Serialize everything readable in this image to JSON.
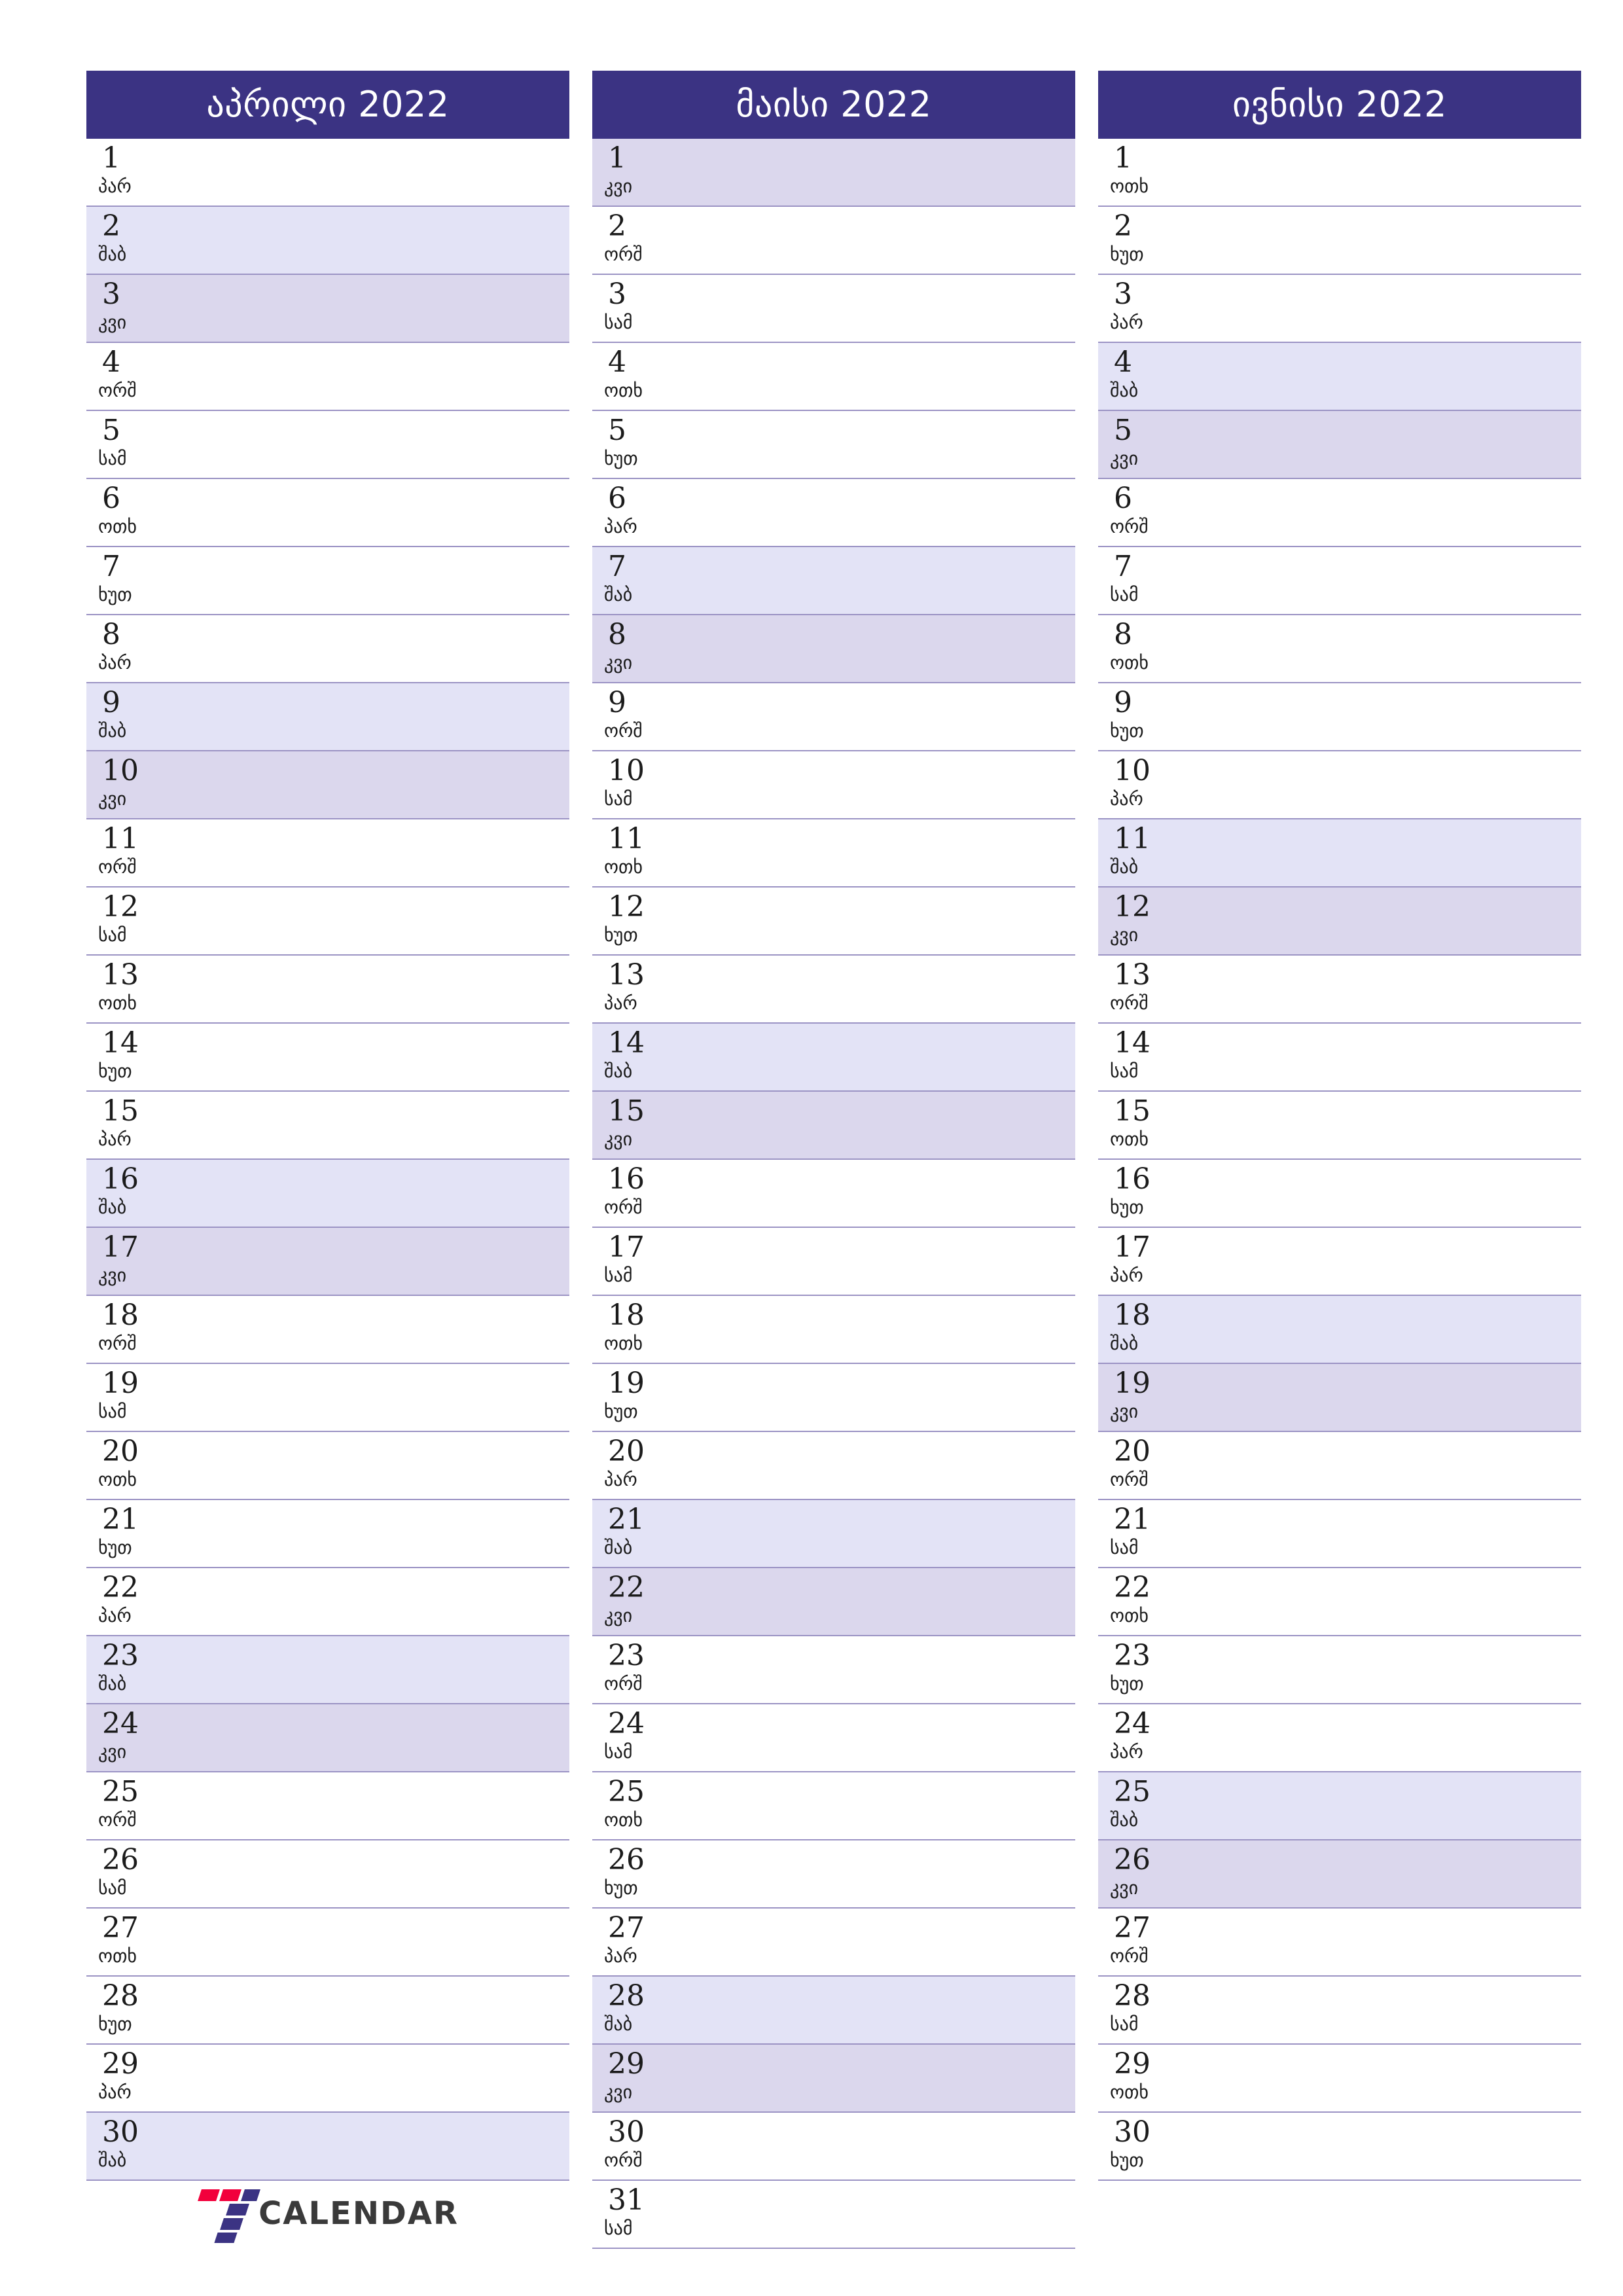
{
  "document": {
    "type": "calendar-planner",
    "year": "2022",
    "locale": "ka",
    "page_size": "A4-portrait"
  },
  "colors": {
    "header_bg": "#3B3383",
    "header_text": "#FFFFFF",
    "saturday_bg": "#E3E3F6",
    "sunday_bg": "#DBD7ED",
    "weekday_bg": "#FFFFFF",
    "row_divider": "#9B93C4",
    "day_text": "#1B1B1B",
    "logo_red": "#F2003C",
    "logo_purple": "#3B3383",
    "logo_text": "#3A3A3A"
  },
  "weekday_abbr": {
    "mon": "ორშ",
    "tue": "სამ",
    "wed": "ოთხ",
    "thu": "ხუთ",
    "fri": "პარ",
    "sat": "შაბ",
    "sun": "კვი"
  },
  "logo": {
    "mark": "seven-logo-mark",
    "text": "CALENDAR"
  },
  "months": [
    {
      "title": "აპრილი 2022",
      "name": "აპრილი",
      "year": "2022",
      "days": [
        {
          "n": "1",
          "w": "პარ",
          "t": "weekday"
        },
        {
          "n": "2",
          "w": "შაბ",
          "t": "sat"
        },
        {
          "n": "3",
          "w": "კვი",
          "t": "sun"
        },
        {
          "n": "4",
          "w": "ორშ",
          "t": "weekday"
        },
        {
          "n": "5",
          "w": "სამ",
          "t": "weekday"
        },
        {
          "n": "6",
          "w": "ოთხ",
          "t": "weekday"
        },
        {
          "n": "7",
          "w": "ხუთ",
          "t": "weekday"
        },
        {
          "n": "8",
          "w": "პარ",
          "t": "weekday"
        },
        {
          "n": "9",
          "w": "შაბ",
          "t": "sat"
        },
        {
          "n": "10",
          "w": "კვი",
          "t": "sun"
        },
        {
          "n": "11",
          "w": "ორშ",
          "t": "weekday"
        },
        {
          "n": "12",
          "w": "სამ",
          "t": "weekday"
        },
        {
          "n": "13",
          "w": "ოთხ",
          "t": "weekday"
        },
        {
          "n": "14",
          "w": "ხუთ",
          "t": "weekday"
        },
        {
          "n": "15",
          "w": "პარ",
          "t": "weekday"
        },
        {
          "n": "16",
          "w": "შაბ",
          "t": "sat"
        },
        {
          "n": "17",
          "w": "კვი",
          "t": "sun"
        },
        {
          "n": "18",
          "w": "ორშ",
          "t": "weekday"
        },
        {
          "n": "19",
          "w": "სამ",
          "t": "weekday"
        },
        {
          "n": "20",
          "w": "ოთხ",
          "t": "weekday"
        },
        {
          "n": "21",
          "w": "ხუთ",
          "t": "weekday"
        },
        {
          "n": "22",
          "w": "პარ",
          "t": "weekday"
        },
        {
          "n": "23",
          "w": "შაბ",
          "t": "sat"
        },
        {
          "n": "24",
          "w": "კვი",
          "t": "sun"
        },
        {
          "n": "25",
          "w": "ორშ",
          "t": "weekday"
        },
        {
          "n": "26",
          "w": "სამ",
          "t": "weekday"
        },
        {
          "n": "27",
          "w": "ოთხ",
          "t": "weekday"
        },
        {
          "n": "28",
          "w": "ხუთ",
          "t": "weekday"
        },
        {
          "n": "29",
          "w": "პარ",
          "t": "weekday"
        },
        {
          "n": "30",
          "w": "შაბ",
          "t": "sat"
        }
      ]
    },
    {
      "title": "მაისი 2022",
      "name": "მაისი",
      "year": "2022",
      "days": [
        {
          "n": "1",
          "w": "კვი",
          "t": "sun"
        },
        {
          "n": "2",
          "w": "ორშ",
          "t": "weekday"
        },
        {
          "n": "3",
          "w": "სამ",
          "t": "weekday"
        },
        {
          "n": "4",
          "w": "ოთხ",
          "t": "weekday"
        },
        {
          "n": "5",
          "w": "ხუთ",
          "t": "weekday"
        },
        {
          "n": "6",
          "w": "პარ",
          "t": "weekday"
        },
        {
          "n": "7",
          "w": "შაბ",
          "t": "sat"
        },
        {
          "n": "8",
          "w": "კვი",
          "t": "sun"
        },
        {
          "n": "9",
          "w": "ორშ",
          "t": "weekday"
        },
        {
          "n": "10",
          "w": "სამ",
          "t": "weekday"
        },
        {
          "n": "11",
          "w": "ოთხ",
          "t": "weekday"
        },
        {
          "n": "12",
          "w": "ხუთ",
          "t": "weekday"
        },
        {
          "n": "13",
          "w": "პარ",
          "t": "weekday"
        },
        {
          "n": "14",
          "w": "შაბ",
          "t": "sat"
        },
        {
          "n": "15",
          "w": "კვი",
          "t": "sun"
        },
        {
          "n": "16",
          "w": "ორშ",
          "t": "weekday"
        },
        {
          "n": "17",
          "w": "სამ",
          "t": "weekday"
        },
        {
          "n": "18",
          "w": "ოთხ",
          "t": "weekday"
        },
        {
          "n": "19",
          "w": "ხუთ",
          "t": "weekday"
        },
        {
          "n": "20",
          "w": "პარ",
          "t": "weekday"
        },
        {
          "n": "21",
          "w": "შაბ",
          "t": "sat"
        },
        {
          "n": "22",
          "w": "კვი",
          "t": "sun"
        },
        {
          "n": "23",
          "w": "ორშ",
          "t": "weekday"
        },
        {
          "n": "24",
          "w": "სამ",
          "t": "weekday"
        },
        {
          "n": "25",
          "w": "ოთხ",
          "t": "weekday"
        },
        {
          "n": "26",
          "w": "ხუთ",
          "t": "weekday"
        },
        {
          "n": "27",
          "w": "პარ",
          "t": "weekday"
        },
        {
          "n": "28",
          "w": "შაბ",
          "t": "sat"
        },
        {
          "n": "29",
          "w": "კვი",
          "t": "sun"
        },
        {
          "n": "30",
          "w": "ორშ",
          "t": "weekday"
        },
        {
          "n": "31",
          "w": "სამ",
          "t": "weekday"
        }
      ]
    },
    {
      "title": "ივნისი 2022",
      "name": "ივნისი",
      "year": "2022",
      "days": [
        {
          "n": "1",
          "w": "ოთხ",
          "t": "weekday"
        },
        {
          "n": "2",
          "w": "ხუთ",
          "t": "weekday"
        },
        {
          "n": "3",
          "w": "პარ",
          "t": "weekday"
        },
        {
          "n": "4",
          "w": "შაბ",
          "t": "sat"
        },
        {
          "n": "5",
          "w": "კვი",
          "t": "sun"
        },
        {
          "n": "6",
          "w": "ორშ",
          "t": "weekday"
        },
        {
          "n": "7",
          "w": "სამ",
          "t": "weekday"
        },
        {
          "n": "8",
          "w": "ოთხ",
          "t": "weekday"
        },
        {
          "n": "9",
          "w": "ხუთ",
          "t": "weekday"
        },
        {
          "n": "10",
          "w": "პარ",
          "t": "weekday"
        },
        {
          "n": "11",
          "w": "შაბ",
          "t": "sat"
        },
        {
          "n": "12",
          "w": "კვი",
          "t": "sun"
        },
        {
          "n": "13",
          "w": "ორშ",
          "t": "weekday"
        },
        {
          "n": "14",
          "w": "სამ",
          "t": "weekday"
        },
        {
          "n": "15",
          "w": "ოთხ",
          "t": "weekday"
        },
        {
          "n": "16",
          "w": "ხუთ",
          "t": "weekday"
        },
        {
          "n": "17",
          "w": "პარ",
          "t": "weekday"
        },
        {
          "n": "18",
          "w": "შაბ",
          "t": "sat"
        },
        {
          "n": "19",
          "w": "კვი",
          "t": "sun"
        },
        {
          "n": "20",
          "w": "ორშ",
          "t": "weekday"
        },
        {
          "n": "21",
          "w": "სამ",
          "t": "weekday"
        },
        {
          "n": "22",
          "w": "ოთხ",
          "t": "weekday"
        },
        {
          "n": "23",
          "w": "ხუთ",
          "t": "weekday"
        },
        {
          "n": "24",
          "w": "პარ",
          "t": "weekday"
        },
        {
          "n": "25",
          "w": "შაბ",
          "t": "sat"
        },
        {
          "n": "26",
          "w": "კვი",
          "t": "sun"
        },
        {
          "n": "27",
          "w": "ორშ",
          "t": "weekday"
        },
        {
          "n": "28",
          "w": "სამ",
          "t": "weekday"
        },
        {
          "n": "29",
          "w": "ოთხ",
          "t": "weekday"
        },
        {
          "n": "30",
          "w": "ხუთ",
          "t": "weekday"
        }
      ]
    }
  ]
}
